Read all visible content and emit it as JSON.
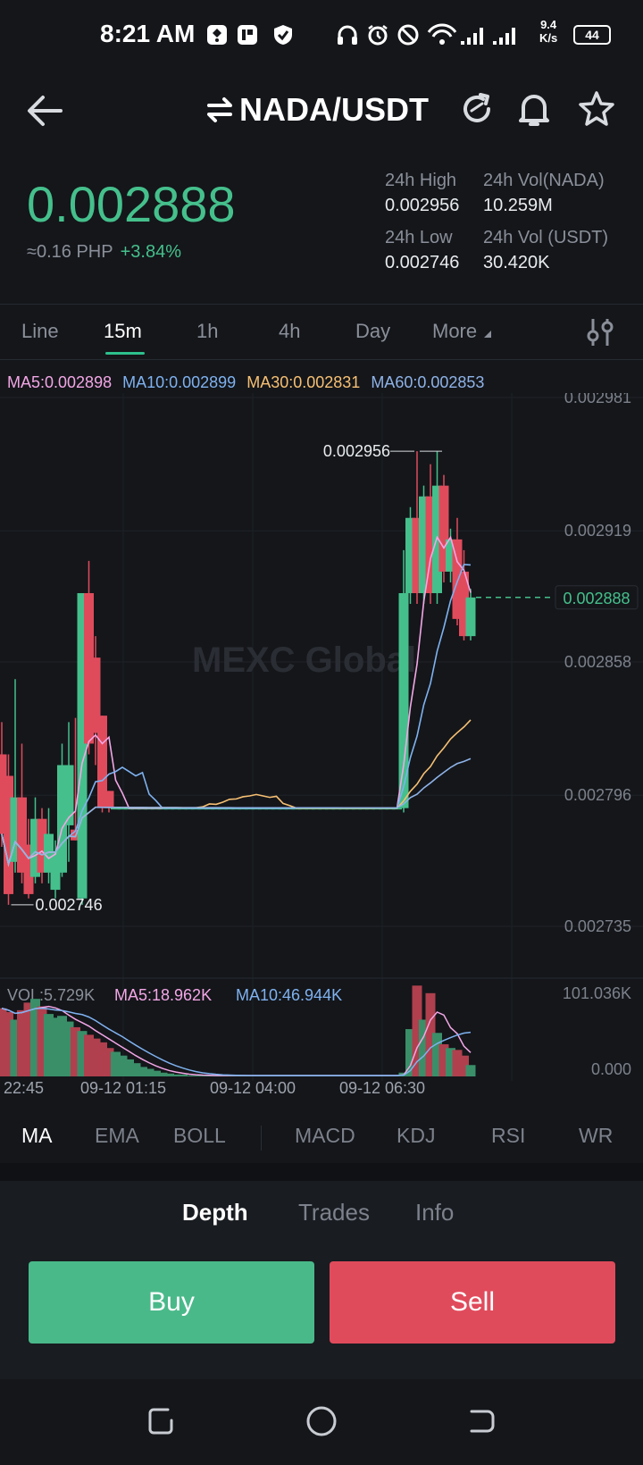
{
  "status_bar": {
    "time": "8:21 AM",
    "net_speed_value": "9.4",
    "net_speed_unit": "K/s",
    "battery": "44"
  },
  "header": {
    "pair": "NADA/USDT",
    "icons": [
      "back-arrow-icon",
      "swap-icon",
      "refresh-icon",
      "bell-icon",
      "star-icon"
    ]
  },
  "price": {
    "last": "0.002888",
    "php": "≈0.16 PHP",
    "change": "+3.84%"
  },
  "stats": {
    "high_label": "24h High",
    "high_value": "0.002956",
    "low_label": "24h Low",
    "low_value": "0.002746",
    "vol_base_label": "24h Vol(NADA)",
    "vol_base_value": "10.259M",
    "vol_quote_label": "24h Vol (USDT)",
    "vol_quote_value": "30.420K"
  },
  "interval_tabs": [
    "Line",
    "15m",
    "1h",
    "4h",
    "Day",
    "More"
  ],
  "active_interval": "15m",
  "ma_legend": {
    "ma5": "MA5:0.002898",
    "ma10": "MA10:0.002899",
    "ma30": "MA30:0.002831",
    "ma60": "MA60:0.002853"
  },
  "volume_legend": {
    "vol": "VOL:5.729K",
    "ma5": "MA5:18.962K",
    "ma10": "MA10:46.944K"
  },
  "indicator_tabs": [
    "MA",
    "EMA",
    "BOLL",
    "MACD",
    "KDJ",
    "RSI",
    "WR"
  ],
  "active_indicator": "MA",
  "bottom_tabs": [
    "Depth",
    "Trades",
    "Info"
  ],
  "active_bottom_tab": "Depth",
  "buttons": {
    "buy": "Buy",
    "sell": "Sell"
  },
  "watermark": "MEXC Global",
  "colors": {
    "up": "#45c08c",
    "down": "#e04b5c",
    "ma5": "#f3a6e6",
    "ma10": "#7fb2f0",
    "ma30": "#f7c073",
    "ma60": "#8fb3e8",
    "background": "#14161a"
  },
  "chart_data": {
    "type": "candlestick",
    "y_ticks": [
      "0.002981",
      "0.002919",
      "0.002858",
      "0.002796",
      "0.002735"
    ],
    "ylim": [
      0.002735,
      0.002981
    ],
    "current_price_label": "0.002888",
    "high_annotation": "0.002956",
    "low_annotation": "0.002746",
    "x_ticks": [
      "22:45",
      "09-12 01:15",
      "09-12 04:00",
      "09-12 06:30"
    ],
    "volume_ticks": [
      "101.036K",
      "0.000"
    ],
    "volume_ylim": [
      0,
      101.036
    ],
    "candles": [
      {
        "o": 0.002815,
        "c": 0.002778,
        "h": 0.00283,
        "l": 0.002772
      },
      {
        "o": 0.002805,
        "c": 0.00275,
        "h": 0.002815,
        "l": 0.002745
      },
      {
        "o": 0.002765,
        "c": 0.002795,
        "h": 0.00285,
        "l": 0.00276
      },
      {
        "o": 0.002795,
        "c": 0.00276,
        "h": 0.00282,
        "l": 0.002755
      },
      {
        "o": 0.002773,
        "c": 0.00275,
        "h": 0.002785,
        "l": 0.002748
      },
      {
        "o": 0.002758,
        "c": 0.002785,
        "h": 0.002795,
        "l": 0.002755
      },
      {
        "o": 0.002785,
        "c": 0.00276,
        "h": 0.00279,
        "l": 0.002755
      },
      {
        "o": 0.00276,
        "c": 0.002778,
        "h": 0.00279,
        "l": 0.002755
      },
      {
        "o": 0.002752,
        "c": 0.00277,
        "h": 0.002775,
        "l": 0.002748
      },
      {
        "o": 0.00276,
        "c": 0.00281,
        "h": 0.00282,
        "l": 0.002758
      },
      {
        "o": 0.002782,
        "c": 0.00281,
        "h": 0.00283,
        "l": 0.002765
      },
      {
        "o": 0.00278,
        "c": 0.002775,
        "h": 0.002832,
        "l": 0.002775
      },
      {
        "o": 0.002748,
        "c": 0.00289,
        "h": 0.00289,
        "l": 0.002745
      },
      {
        "o": 0.00289,
        "c": 0.00282,
        "h": 0.002905,
        "l": 0.002815
      },
      {
        "o": 0.00286,
        "c": 0.002825,
        "h": 0.00287,
        "l": 0.00281
      },
      {
        "o": 0.002833,
        "c": 0.00279,
        "h": 0.002833,
        "l": 0.002788
      },
      {
        "o": 0.002798,
        "c": 0.00279,
        "h": 0.002798,
        "l": 0.002788
      },
      {
        "o": 0.00279,
        "c": 0.00279,
        "h": 0.00279,
        "l": 0.00279
      },
      {
        "o": 0.00279,
        "c": 0.00279,
        "h": 0.00279,
        "l": 0.00279
      },
      {
        "o": 0.00279,
        "c": 0.00279,
        "h": 0.00279,
        "l": 0.00279
      },
      {
        "o": 0.00279,
        "c": 0.00279,
        "h": 0.00279,
        "l": 0.00279
      },
      {
        "o": 0.00279,
        "c": 0.00279,
        "h": 0.00279,
        "l": 0.00279
      },
      {
        "o": 0.00279,
        "c": 0.00279,
        "h": 0.00279,
        "l": 0.00279
      },
      {
        "o": 0.00279,
        "c": 0.00279,
        "h": 0.00279,
        "l": 0.00279
      },
      {
        "o": 0.00279,
        "c": 0.00279,
        "h": 0.00279,
        "l": 0.00279
      },
      {
        "o": 0.00279,
        "c": 0.00279,
        "h": 0.00279,
        "l": 0.00279
      },
      {
        "o": 0.00279,
        "c": 0.00279,
        "h": 0.00279,
        "l": 0.00279
      },
      {
        "o": 0.00279,
        "c": 0.00279,
        "h": 0.00279,
        "l": 0.00279
      },
      {
        "o": 0.00279,
        "c": 0.00279,
        "h": 0.00279,
        "l": 0.00279
      },
      {
        "o": 0.00279,
        "c": 0.00279,
        "h": 0.00279,
        "l": 0.00279
      },
      {
        "o": 0.00279,
        "c": 0.00279,
        "h": 0.00279,
        "l": 0.00279
      },
      {
        "o": 0.00279,
        "c": 0.00279,
        "h": 0.00279,
        "l": 0.00279
      },
      {
        "o": 0.00279,
        "c": 0.00279,
        "h": 0.00279,
        "l": 0.00279
      },
      {
        "o": 0.00279,
        "c": 0.00279,
        "h": 0.00279,
        "l": 0.00279
      },
      {
        "o": 0.00279,
        "c": 0.00279,
        "h": 0.00279,
        "l": 0.00279
      },
      {
        "o": 0.00279,
        "c": 0.00279,
        "h": 0.00279,
        "l": 0.00279
      },
      {
        "o": 0.00279,
        "c": 0.00279,
        "h": 0.00279,
        "l": 0.00279
      },
      {
        "o": 0.00279,
        "c": 0.00279,
        "h": 0.00279,
        "l": 0.00279
      },
      {
        "o": 0.00279,
        "c": 0.00279,
        "h": 0.00279,
        "l": 0.00279
      },
      {
        "o": 0.00279,
        "c": 0.00279,
        "h": 0.00279,
        "l": 0.00279
      },
      {
        "o": 0.00279,
        "c": 0.00279,
        "h": 0.00279,
        "l": 0.00279
      },
      {
        "o": 0.00279,
        "c": 0.00279,
        "h": 0.00279,
        "l": 0.00279
      },
      {
        "o": 0.00279,
        "c": 0.00279,
        "h": 0.00279,
        "l": 0.00279
      },
      {
        "o": 0.00279,
        "c": 0.00279,
        "h": 0.00279,
        "l": 0.00279
      },
      {
        "o": 0.00279,
        "c": 0.00279,
        "h": 0.00279,
        "l": 0.00279
      },
      {
        "o": 0.00279,
        "c": 0.00279,
        "h": 0.00279,
        "l": 0.00279
      },
      {
        "o": 0.00279,
        "c": 0.00279,
        "h": 0.00279,
        "l": 0.00279
      },
      {
        "o": 0.00279,
        "c": 0.00279,
        "h": 0.00279,
        "l": 0.00279
      },
      {
        "o": 0.00279,
        "c": 0.00279,
        "h": 0.00279,
        "l": 0.00279
      },
      {
        "o": 0.00279,
        "c": 0.00279,
        "h": 0.00279,
        "l": 0.00279
      },
      {
        "o": 0.00279,
        "c": 0.00279,
        "h": 0.00279,
        "l": 0.00279
      },
      {
        "o": 0.00279,
        "c": 0.00279,
        "h": 0.00279,
        "l": 0.00279
      },
      {
        "o": 0.00279,
        "c": 0.00279,
        "h": 0.00279,
        "l": 0.00279
      },
      {
        "o": 0.00279,
        "c": 0.00279,
        "h": 0.00279,
        "l": 0.00279
      },
      {
        "o": 0.00279,
        "c": 0.00279,
        "h": 0.00279,
        "l": 0.00279
      },
      {
        "o": 0.00279,
        "c": 0.00279,
        "h": 0.00279,
        "l": 0.00279
      },
      {
        "o": 0.00279,
        "c": 0.00279,
        "h": 0.00279,
        "l": 0.00279
      },
      {
        "o": 0.00279,
        "c": 0.00279,
        "h": 0.00279,
        "l": 0.00279
      },
      {
        "o": 0.00279,
        "c": 0.00279,
        "h": 0.00279,
        "l": 0.00279
      },
      {
        "o": 0.00279,
        "c": 0.00279,
        "h": 0.00279,
        "l": 0.00279
      },
      {
        "o": 0.00279,
        "c": 0.00289,
        "h": 0.00291,
        "l": 0.002788
      },
      {
        "o": 0.00289,
        "c": 0.002925,
        "h": 0.00293,
        "l": 0.002885
      },
      {
        "o": 0.002925,
        "c": 0.00289,
        "h": 0.002956,
        "l": 0.002885
      },
      {
        "o": 0.00289,
        "c": 0.002935,
        "h": 0.00294,
        "l": 0.002885
      },
      {
        "o": 0.002935,
        "c": 0.00289,
        "h": 0.00295,
        "l": 0.002885
      },
      {
        "o": 0.00289,
        "c": 0.00294,
        "h": 0.002956,
        "l": 0.002885
      },
      {
        "o": 0.00294,
        "c": 0.0029,
        "h": 0.002945,
        "l": 0.002895
      },
      {
        "o": 0.0029,
        "c": 0.002915,
        "h": 0.00292,
        "l": 0.002895
      },
      {
        "o": 0.002915,
        "c": 0.002878,
        "h": 0.002925,
        "l": 0.002875
      },
      {
        "o": 0.0029,
        "c": 0.00287,
        "h": 0.00291,
        "l": 0.002868
      },
      {
        "o": 0.00287,
        "c": 0.002888,
        "h": 0.002892,
        "l": 0.002868
      }
    ],
    "volumes": [
      72,
      68,
      60,
      70,
      78,
      82,
      74,
      66,
      62,
      64,
      58,
      52,
      48,
      44,
      40,
      36,
      30,
      26,
      22,
      18,
      14,
      10,
      8,
      6,
      4,
      3,
      2,
      2,
      1,
      1,
      1,
      1,
      1,
      1,
      1,
      1,
      1,
      1,
      1,
      1,
      1,
      1,
      1,
      1,
      1,
      1,
      1,
      1,
      1,
      1,
      1,
      1,
      1,
      1,
      1,
      1,
      1,
      1,
      1,
      1,
      4,
      50,
      96,
      60,
      88,
      46,
      34,
      30,
      28,
      22,
      12
    ]
  }
}
